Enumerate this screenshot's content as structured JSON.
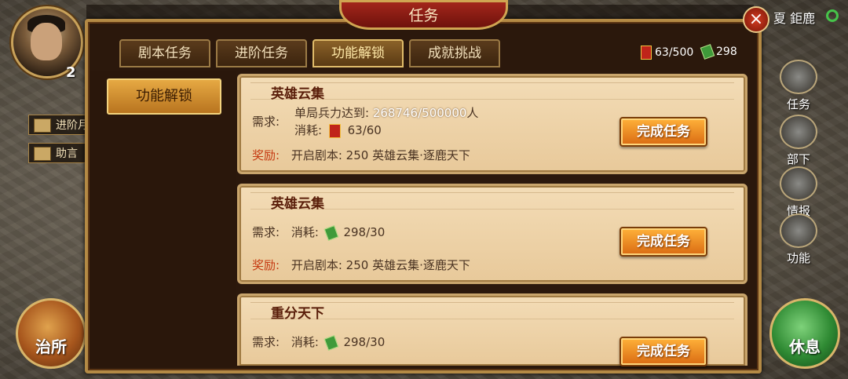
{
  "hud": {
    "level": "2",
    "side_items": [
      {
        "label": "进阶月"
      },
      {
        "label": "助言"
      }
    ],
    "location": "夏 鉅鹿",
    "left_button": "治所",
    "right_button": "休息",
    "right_menu": [
      {
        "label": "任务"
      },
      {
        "label": "部下"
      },
      {
        "label": "情报"
      },
      {
        "label": "功能"
      }
    ]
  },
  "panel": {
    "title": "任务",
    "close": "×",
    "tabs": [
      {
        "label": "剧本任务",
        "active": false
      },
      {
        "label": "进阶任务",
        "active": false
      },
      {
        "label": "功能解锁",
        "active": true
      },
      {
        "label": "成就挑战",
        "active": false
      }
    ],
    "resources": {
      "red": "63/500",
      "green": "298"
    },
    "side_tab": "功能解锁"
  },
  "tasks": [
    {
      "title": "英雄云集",
      "req_label": "需求:",
      "req_line1_text": "单局兵力达到:",
      "req_line1_value": "268746/500000",
      "req_line1_unit": "人",
      "cost_label": "消耗:",
      "cost_value": "63/60",
      "cost_icon": "red-token-icon",
      "reward_label": "奖励:",
      "reward_text": "开启剧本: 250 英雄云集·逐鹿天下",
      "button": "完成任务"
    },
    {
      "title": "英雄云集",
      "req_label": "需求:",
      "cost_label": "消耗:",
      "cost_value": "298/30",
      "cost_icon": "green-jade-icon",
      "reward_label": "奖励:",
      "reward_text": "开启剧本: 250 英雄云集·逐鹿天下",
      "button": "完成任务"
    },
    {
      "title": "重分天下",
      "req_label": "需求:",
      "cost_label": "消耗:",
      "cost_value": "298/30",
      "cost_icon": "green-jade-icon",
      "button": "完成任务"
    }
  ]
}
